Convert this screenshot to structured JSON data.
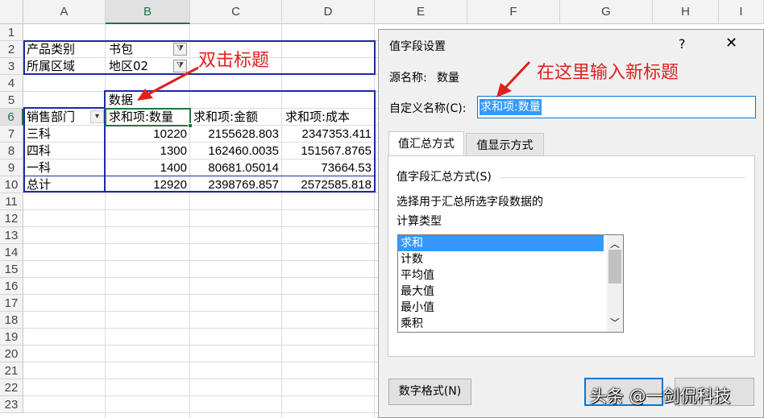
{
  "sheet": {
    "columns": [
      "A",
      "B",
      "C",
      "D",
      "E",
      "F",
      "G",
      "H",
      "I"
    ],
    "rows": [
      "1",
      "2",
      "3",
      "4",
      "5",
      "6",
      "7",
      "8",
      "9",
      "10",
      "11",
      "12",
      "13",
      "14",
      "15",
      "16",
      "17",
      "18",
      "19",
      "20",
      "21",
      "22",
      "23"
    ],
    "filters": [
      {
        "label": "产品类别",
        "value": "书包"
      },
      {
        "label": "所属区域",
        "value": "地区02"
      }
    ],
    "data_caption": "数据",
    "row_label_header": "销售部门",
    "value_headers": [
      "求和项:数量",
      "求和项:金额",
      "求和项:成本"
    ],
    "body": [
      {
        "label": "三科",
        "values": [
          "10220",
          "2155628.803",
          "2347353.411"
        ]
      },
      {
        "label": "四科",
        "values": [
          "1300",
          "162460.0035",
          "151567.8765"
        ]
      },
      {
        "label": "一科",
        "values": [
          "1400",
          "80681.05014",
          "73664.53"
        ]
      },
      {
        "label": "总计",
        "values": [
          "12920",
          "2398769.857",
          "2572585.818"
        ]
      }
    ]
  },
  "annotations": {
    "left": "双击标题",
    "right": "在这里输入新标题"
  },
  "dialog": {
    "title": "值字段设置",
    "help": "?",
    "close": "✕",
    "source_label": "源名称:",
    "source_value": "数量",
    "custom_name_label": "自定义名称(C):",
    "custom_name_value": "求和项:数量",
    "tabs": [
      "值汇总方式",
      "值显示方式"
    ],
    "section_title": "值字段汇总方式(S)",
    "desc1": "选择用于汇总所选字段数据的",
    "desc2": "计算类型",
    "calc_types": [
      "求和",
      "计数",
      "平均值",
      "最大值",
      "最小值",
      "乘积"
    ],
    "number_format_button": "数字格式(N)",
    "watermark": "头条 @一剑侃科技"
  },
  "colors": {
    "pivot_border": "#1a2aa6",
    "selection": "#3399ff",
    "annotation": "#e02020",
    "excel_green": "#217346"
  }
}
